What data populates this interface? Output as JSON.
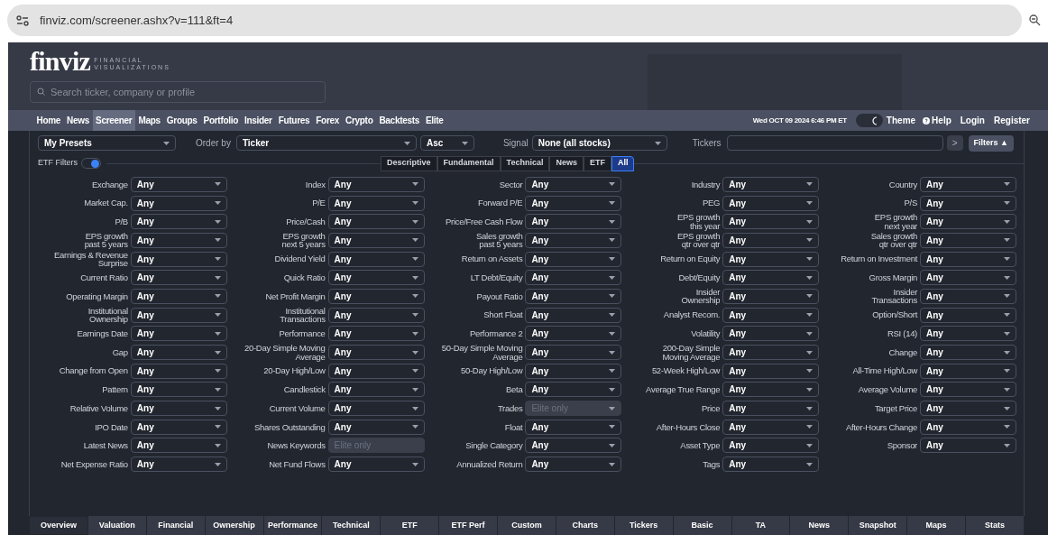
{
  "browser": {
    "url": "finviz.com/screener.ashx?v=111&ft=4"
  },
  "header": {
    "logo": "finviz",
    "tagline": "FINANCIAL\nVISUALIZATIONS",
    "search": {
      "placeholder": "Search ticker, company or profile"
    }
  },
  "nav": {
    "items": [
      {
        "label": "Home",
        "selected": false
      },
      {
        "label": "News",
        "selected": false
      },
      {
        "label": "Screener",
        "selected": true
      },
      {
        "label": "Maps",
        "selected": false
      },
      {
        "label": "Groups",
        "selected": false
      },
      {
        "label": "Portfolio",
        "selected": false
      },
      {
        "label": "Insider",
        "selected": false
      },
      {
        "label": "Futures",
        "selected": false
      },
      {
        "label": "Forex",
        "selected": false
      },
      {
        "label": "Crypto",
        "selected": false
      },
      {
        "label": "Backtests",
        "selected": false
      },
      {
        "label": "Elite",
        "selected": false
      }
    ],
    "datetime": "Wed OCT 09 2024 6:46 PM ET",
    "theme": "Theme",
    "dark_mode": true,
    "help": "Help",
    "login": "Login",
    "register": "Register"
  },
  "toolbar": {
    "presets": "My Presets",
    "order_label": "Order by",
    "order": "Ticker",
    "direction": "Asc",
    "signal_label": "Signal",
    "signal": "None (all stocks)",
    "tickers_label": "Tickers",
    "go": ">",
    "filters": "Filters ▲"
  },
  "etf_filters": {
    "label": "ETF Filters",
    "on": true
  },
  "filter_tabs": [
    {
      "label": "Descriptive",
      "selected": false
    },
    {
      "label": "Fundamental",
      "selected": false
    },
    {
      "label": "Technical",
      "selected": false
    },
    {
      "label": "News",
      "selected": false
    },
    {
      "label": "ETF",
      "selected": false
    },
    {
      "label": "All",
      "selected": true
    }
  ],
  "filters": [
    {
      "label": "Exchange",
      "value": "Any",
      "disabled": false
    },
    {
      "label": "Index",
      "value": "Any",
      "disabled": false
    },
    {
      "label": "Sector",
      "value": "Any",
      "disabled": false
    },
    {
      "label": "Industry",
      "value": "Any",
      "disabled": false
    },
    {
      "label": "Country",
      "value": "Any",
      "disabled": false
    },
    {
      "label": "Market Cap.",
      "value": "Any",
      "disabled": false
    },
    {
      "label": "P/E",
      "value": "Any",
      "disabled": false
    },
    {
      "label": "Forward P/E",
      "value": "Any",
      "disabled": false
    },
    {
      "label": "PEG",
      "value": "Any",
      "disabled": false
    },
    {
      "label": "P/S",
      "value": "Any",
      "disabled": false
    },
    {
      "label": "P/B",
      "value": "Any",
      "disabled": false
    },
    {
      "label": "Price/Cash",
      "value": "Any",
      "disabled": false
    },
    {
      "label": "Price/Free Cash Flow",
      "value": "Any",
      "disabled": false
    },
    {
      "label": "EPS growth\nthis year",
      "value": "Any",
      "disabled": false
    },
    {
      "label": "EPS growth\nnext year",
      "value": "Any",
      "disabled": false
    },
    {
      "label": "EPS growth\npast 5 years",
      "value": "Any",
      "disabled": false
    },
    {
      "label": "EPS growth\nnext 5 years",
      "value": "Any",
      "disabled": false
    },
    {
      "label": "Sales growth\npast 5 years",
      "value": "Any",
      "disabled": false
    },
    {
      "label": "EPS growth\nqtr over qtr",
      "value": "Any",
      "disabled": false
    },
    {
      "label": "Sales growth\nqtr over qtr",
      "value": "Any",
      "disabled": false
    },
    {
      "label": "Earnings & Revenue\nSurprise",
      "value": "Any",
      "disabled": false
    },
    {
      "label": "Dividend Yield",
      "value": "Any",
      "disabled": false
    },
    {
      "label": "Return on Assets",
      "value": "Any",
      "disabled": false
    },
    {
      "label": "Return on Equity",
      "value": "Any",
      "disabled": false
    },
    {
      "label": "Return on Investment",
      "value": "Any",
      "disabled": false
    },
    {
      "label": "Current Ratio",
      "value": "Any",
      "disabled": false
    },
    {
      "label": "Quick Ratio",
      "value": "Any",
      "disabled": false
    },
    {
      "label": "LT Debt/Equity",
      "value": "Any",
      "disabled": false
    },
    {
      "label": "Debt/Equity",
      "value": "Any",
      "disabled": false
    },
    {
      "label": "Gross Margin",
      "value": "Any",
      "disabled": false
    },
    {
      "label": "Operating Margin",
      "value": "Any",
      "disabled": false
    },
    {
      "label": "Net Profit Margin",
      "value": "Any",
      "disabled": false
    },
    {
      "label": "Payout Ratio",
      "value": "Any",
      "disabled": false
    },
    {
      "label": "Insider\nOwnership",
      "value": "Any",
      "disabled": false
    },
    {
      "label": "Insider\nTransactions",
      "value": "Any",
      "disabled": false
    },
    {
      "label": "Institutional\nOwnership",
      "value": "Any",
      "disabled": false
    },
    {
      "label": "Institutional\nTransactions",
      "value": "Any",
      "disabled": false
    },
    {
      "label": "Short Float",
      "value": "Any",
      "disabled": false
    },
    {
      "label": "Analyst Recom.",
      "value": "Any",
      "disabled": false
    },
    {
      "label": "Option/Short",
      "value": "Any",
      "disabled": false
    },
    {
      "label": "Earnings Date",
      "value": "Any",
      "disabled": false
    },
    {
      "label": "Performance",
      "value": "Any",
      "disabled": false
    },
    {
      "label": "Performance 2",
      "value": "Any",
      "disabled": false
    },
    {
      "label": "Volatility",
      "value": "Any",
      "disabled": false
    },
    {
      "label": "RSI (14)",
      "value": "Any",
      "disabled": false
    },
    {
      "label": "Gap",
      "value": "Any",
      "disabled": false
    },
    {
      "label": "20-Day Simple Moving\nAverage",
      "value": "Any",
      "disabled": false
    },
    {
      "label": "50-Day Simple Moving\nAverage",
      "value": "Any",
      "disabled": false
    },
    {
      "label": "200-Day Simple\nMoving Average",
      "value": "Any",
      "disabled": false
    },
    {
      "label": "Change",
      "value": "Any",
      "disabled": false
    },
    {
      "label": "Change from Open",
      "value": "Any",
      "disabled": false
    },
    {
      "label": "20-Day High/Low",
      "value": "Any",
      "disabled": false
    },
    {
      "label": "50-Day High/Low",
      "value": "Any",
      "disabled": false
    },
    {
      "label": "52-Week High/Low",
      "value": "Any",
      "disabled": false
    },
    {
      "label": "All-Time High/Low",
      "value": "Any",
      "disabled": false
    },
    {
      "label": "Pattern",
      "value": "Any",
      "disabled": false
    },
    {
      "label": "Candlestick",
      "value": "Any",
      "disabled": false
    },
    {
      "label": "Beta",
      "value": "Any",
      "disabled": false
    },
    {
      "label": "Average True Range",
      "value": "Any",
      "disabled": false
    },
    {
      "label": "Average Volume",
      "value": "Any",
      "disabled": false
    },
    {
      "label": "Relative Volume",
      "value": "Any",
      "disabled": false
    },
    {
      "label": "Current Volume",
      "value": "Any",
      "disabled": false
    },
    {
      "label": "Trades",
      "value": "Elite only",
      "disabled": true
    },
    {
      "label": "Price",
      "value": "Any",
      "disabled": false
    },
    {
      "label": "Target Price",
      "value": "Any",
      "disabled": false
    },
    {
      "label": "IPO Date",
      "value": "Any",
      "disabled": false
    },
    {
      "label": "Shares Outstanding",
      "value": "Any",
      "disabled": false
    },
    {
      "label": "Float",
      "value": "Any",
      "disabled": false
    },
    {
      "label": "After-Hours Close",
      "value": "Any",
      "disabled": false
    },
    {
      "label": "After-Hours Change",
      "value": "Any",
      "disabled": false
    },
    {
      "label": "Latest News",
      "value": "Any",
      "disabled": false
    },
    {
      "label": "News Keywords",
      "value": "Elite only",
      "disabled": true,
      "kind": "text"
    },
    {
      "label": "Single Category",
      "value": "Any",
      "disabled": false
    },
    {
      "label": "Asset Type",
      "value": "Any",
      "disabled": false
    },
    {
      "label": "Sponsor",
      "value": "Any",
      "disabled": false
    },
    {
      "label": "Net Expense Ratio",
      "value": "Any",
      "disabled": false
    },
    {
      "label": "Net Fund Flows",
      "value": "Any",
      "disabled": false
    },
    {
      "label": "Annualized Return",
      "value": "Any",
      "disabled": false
    },
    {
      "label": "Tags",
      "value": "Any",
      "disabled": false
    }
  ],
  "view_tabs": [
    {
      "label": "Overview",
      "selected": true
    },
    {
      "label": "Valuation",
      "selected": false
    },
    {
      "label": "Financial",
      "selected": false
    },
    {
      "label": "Ownership",
      "selected": false
    },
    {
      "label": "Performance",
      "selected": false
    },
    {
      "label": "Technical",
      "selected": false
    },
    {
      "label": "ETF",
      "selected": false
    },
    {
      "label": "ETF Perf",
      "selected": false
    },
    {
      "label": "Custom",
      "selected": false
    },
    {
      "label": "Charts",
      "selected": false
    },
    {
      "label": "Tickers",
      "selected": false
    },
    {
      "label": "Basic",
      "selected": false
    },
    {
      "label": "TA",
      "selected": false
    },
    {
      "label": "News",
      "selected": false
    },
    {
      "label": "Snapshot",
      "selected": false
    },
    {
      "label": "Maps",
      "selected": false
    },
    {
      "label": "Stats",
      "selected": false
    }
  ]
}
